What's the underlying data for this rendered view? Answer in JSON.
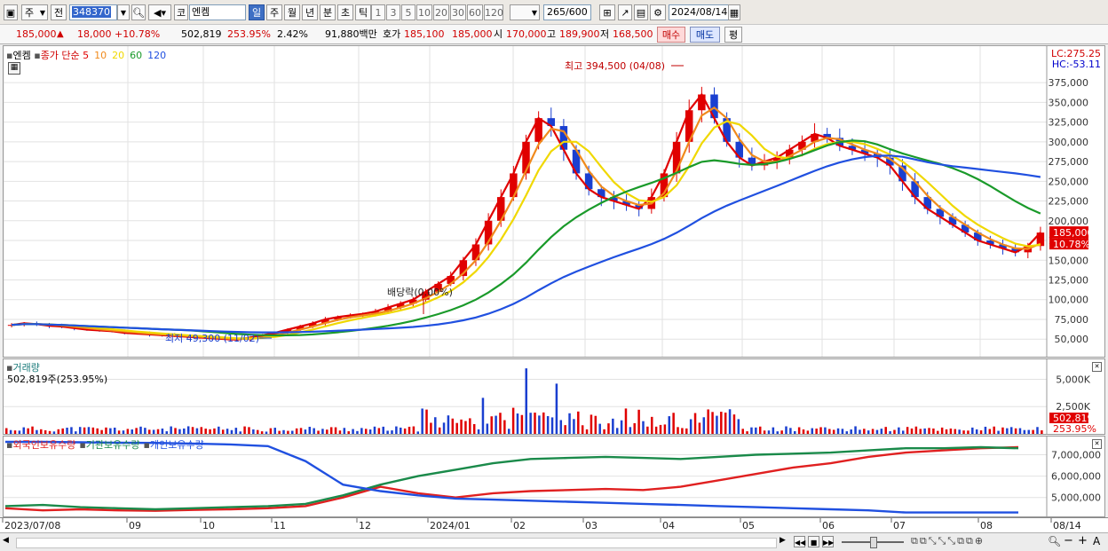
{
  "toolbar": {
    "type_label": "주",
    "scope_label": "전",
    "code": "348370",
    "market": "코",
    "name": "엔켐",
    "periods": [
      "일",
      "주",
      "월",
      "년",
      "분",
      "초",
      "틱"
    ],
    "active_period": "일",
    "intervals": [
      "1",
      "3",
      "5",
      "10",
      "20",
      "30",
      "60",
      "120"
    ],
    "count": "265",
    "count_max": "/600",
    "date": "2024/08/14"
  },
  "info": {
    "price": "185,000",
    "change": "18,000",
    "change_pct": "+10.78%",
    "volume": "502,819",
    "volume_ratio": "253.95%",
    "turnover_rate": "2.42%",
    "amount": "91,880백만",
    "quote_label": "호가",
    "quote1": "185,100",
    "quote2": "185,000",
    "open_label": "시",
    "open": "170,000",
    "high_label": "고",
    "high": "189,900",
    "low_label": "저",
    "low": "168,500",
    "buy_label": "매수",
    "sell_label": "매도",
    "eval_label": "평"
  },
  "price_panel": {
    "legend_name": "엔켐",
    "ma_label": "종가 단순",
    "ma_periods": [
      "5",
      "10",
      "20",
      "60",
      "120"
    ],
    "ma_colors": [
      "#e00000",
      "#f08a1c",
      "#f0d800",
      "#1a9a2a",
      "#2050e0"
    ],
    "lc": "LC:275.25",
    "hc": "HC:-53.11",
    "max_annotation": "최고 394,500 (04/08)",
    "min_annotation": "최저 49,300 (11/02)",
    "dividend_annotation": "배당락(0.00%)",
    "current_price_tag": "185,000",
    "current_pct_tag": "10.78%"
  },
  "volume_panel": {
    "title": "거래량",
    "value": "502,819주(253.95%)",
    "tag_value": "502,819",
    "tag_pct": "253.95%",
    "axis": [
      "5,000K",
      "2,500K"
    ]
  },
  "holdings_panel": {
    "legends": [
      "외국인보유수량",
      "기관보유수량",
      "개인보유수량"
    ],
    "axis": [
      "7,000,000",
      "6,000,000",
      "5,000,000"
    ]
  },
  "date_axis": [
    "2023/07/08",
    "09",
    "10",
    "11",
    "12",
    "2024/01",
    "02",
    "03",
    "04",
    "05",
    "06",
    "07",
    "08",
    "08/14"
  ],
  "chart_data": {
    "type": "line",
    "title": "엔켐",
    "ylim": [
      30000,
      410000
    ],
    "yticks": [
      50000,
      75000,
      100000,
      125000,
      150000,
      175000,
      200000,
      225000,
      250000,
      275000,
      300000,
      325000,
      350000,
      375000
    ],
    "x_months": [
      "2023/07/08",
      "09",
      "10",
      "11",
      "12",
      "2024/01",
      "02",
      "03",
      "04",
      "05",
      "06",
      "07",
      "08"
    ],
    "close": [
      68000,
      70000,
      69000,
      67000,
      66000,
      64000,
      62000,
      61000,
      60000,
      58000,
      57000,
      56000,
      55000,
      54000,
      53000,
      52000,
      51000,
      50000,
      49300,
      52000,
      55000,
      58000,
      62000,
      66000,
      70000,
      75000,
      78000,
      80000,
      82000,
      85000,
      90000,
      95000,
      100000,
      110000,
      120000,
      130000,
      150000,
      170000,
      200000,
      230000,
      260000,
      300000,
      330000,
      320000,
      290000,
      260000,
      240000,
      230000,
      225000,
      220000,
      215000,
      230000,
      260000,
      300000,
      340000,
      360000,
      330000,
      300000,
      280000,
      270000,
      275000,
      280000,
      290000,
      300000,
      310000,
      305000,
      295000,
      290000,
      285000,
      280000,
      270000,
      250000,
      230000,
      215000,
      205000,
      195000,
      185000,
      175000,
      170000,
      165000,
      160000,
      168000,
      185000
    ],
    "series": [
      {
        "name": "5",
        "color": "#e00000"
      },
      {
        "name": "10",
        "color": "#f08a1c"
      },
      {
        "name": "20",
        "color": "#f0d800"
      },
      {
        "name": "60",
        "color": "#1a9a2a"
      },
      {
        "name": "120",
        "color": "#2050e0"
      }
    ],
    "volume_ylim": [
      0,
      6500
    ],
    "holdings": {
      "ylim": [
        4200000,
        7600000
      ],
      "series": [
        {
          "name": "외국인보유수량",
          "color": "#e02020",
          "values": [
            4500000,
            4400000,
            4450000,
            4400000,
            4380000,
            4420000,
            4450000,
            4500000,
            4600000,
            5000000,
            5500000,
            5200000,
            5000000,
            5200000,
            5300000,
            5350000,
            5400000,
            5350000,
            5500000,
            5800000,
            6100000,
            6400000,
            6600000,
            6900000,
            7100000,
            7200000,
            7300000,
            7350000
          ]
        },
        {
          "name": "기관보유수량",
          "color": "#1a8a4a",
          "values": [
            4600000,
            4650000,
            4550000,
            4500000,
            4450000,
            4500000,
            4550000,
            4600000,
            4700000,
            5100000,
            5600000,
            6000000,
            6300000,
            6600000,
            6800000,
            6850000,
            6900000,
            6850000,
            6800000,
            6900000,
            7000000,
            7050000,
            7100000,
            7200000,
            7300000,
            7300000,
            7350000,
            7300000
          ]
        },
        {
          "name": "개인보유수량",
          "color": "#2050e0",
          "values": [
            7600000,
            7600000,
            7580000,
            7560000,
            7550000,
            7520000,
            7480000,
            7400000,
            6700000,
            5600000,
            5300000,
            5100000,
            4950000,
            4900000,
            4850000,
            4800000,
            4750000,
            4700000,
            4650000,
            4600000,
            4550000,
            4500000,
            4450000,
            4400000,
            4300000,
            4300000,
            4300000,
            4300000
          ]
        }
      ]
    }
  }
}
